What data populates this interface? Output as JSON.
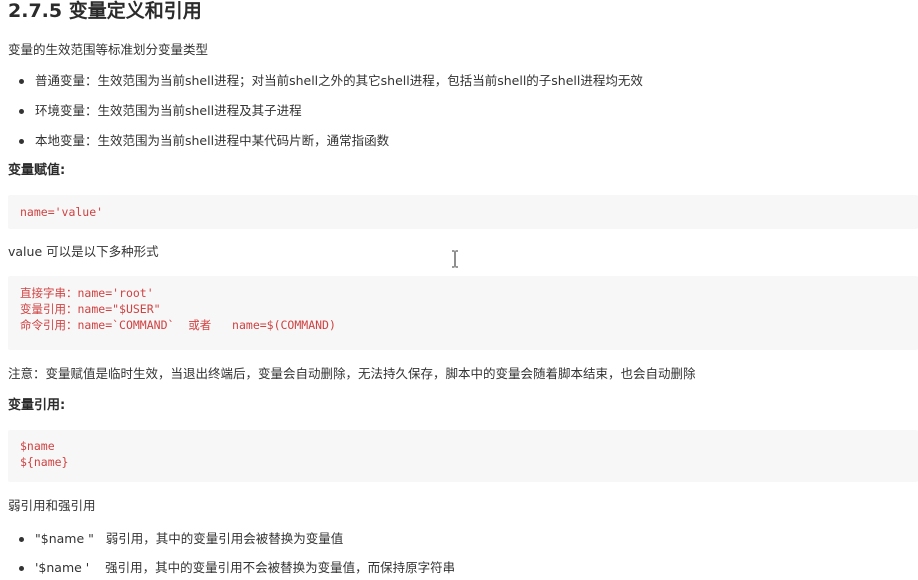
{
  "heading": "2.7.5 变量定义和引用",
  "intro": "变量的生效范围等标准划分变量类型",
  "variable_types": [
    "普通变量：生效范围为当前shell进程；对当前shell之外的其它shell进程，包括当前shell的子shell进程均无效",
    "环境变量：生效范围为当前shell进程及其子进程",
    "本地变量：生效范围为当前shell进程中某代码片断，通常指函数"
  ],
  "assign_heading": "变量赋值:",
  "assign_code": [
    "name='value'"
  ],
  "value_forms_text": "value 可以是以下多种形式",
  "value_forms_code": [
    "直接字串：name='root'",
    "变量引用：name=\"$USER\"",
    "命令引用：name=`COMMAND`  或者   name=$(COMMAND)"
  ],
  "note": "注意：变量赋值是临时生效，当退出终端后，变量会自动删除，无法持久保存，脚本中的变量会随着脚本结束，也会自动删除",
  "ref_heading": "变量引用:",
  "ref_code": [
    "$name",
    "${name}"
  ],
  "quote_intro": "弱引用和强引用",
  "quote_types": [
    "\"$name \"   弱引用，其中的变量引用会被替换为变量值",
    "'$name '    强引用，其中的变量引用不会被替换为变量值，而保持原字符串"
  ],
  "colors": {
    "code_text": "#d14242",
    "code_bg": "#f7f7f7",
    "text": "#333333"
  },
  "cursor_icon": "text-cursor-icon"
}
